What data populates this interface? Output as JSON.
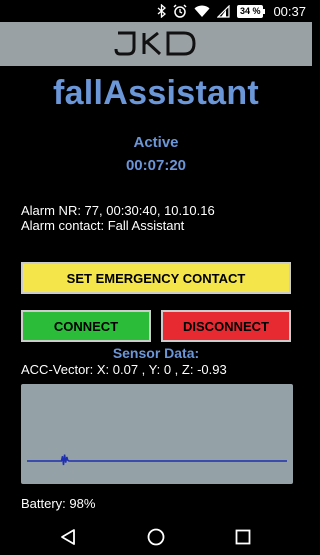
{
  "status_bar": {
    "battery_percent": "34 %",
    "time": "00:37",
    "icons": [
      "bluetooth-icon",
      "alarm-clock-icon",
      "wifi-icon",
      "cell-signal-icon",
      "battery-icon"
    ]
  },
  "header": {
    "logo_text": "JKD"
  },
  "app": {
    "title": "fallAssistant",
    "state": "Active",
    "timer": "00:07:20",
    "alarm_nr": "Alarm NR: 77, 00:30:40, 10.10.16",
    "alarm_contact": "Alarm contact: Fall Assistant"
  },
  "buttons": {
    "emergency": "SET EMERGENCY CONTACT",
    "connect": "CONNECT",
    "disconnect": "DISCONNECT"
  },
  "sensor": {
    "title": "Sensor Data:",
    "acc_label": "ACC-Vector:",
    "x": "X: 0.07 ,",
    "y": "Y: 0 ,",
    "z": "Z: -0.93",
    "graph_series": [
      0,
      0,
      0,
      0,
      0,
      0,
      0,
      0,
      0,
      0,
      0,
      0,
      0,
      0,
      0,
      0,
      0,
      0,
      0,
      0,
      0,
      0,
      0,
      0,
      0,
      0,
      0,
      0,
      0,
      0,
      0,
      0,
      0,
      0.6,
      -0.5,
      0.8,
      -0.2,
      0.5,
      0.1,
      0,
      0,
      0,
      0,
      0,
      0,
      0,
      0,
      0,
      0,
      0,
      0,
      0,
      0,
      0,
      0,
      0,
      0,
      0,
      0,
      0,
      0,
      0,
      0,
      0,
      0,
      0,
      0,
      0,
      0,
      0,
      0,
      0,
      0,
      0,
      0,
      0,
      0,
      0,
      0,
      0,
      0,
      0,
      0,
      0,
      0,
      0,
      0,
      0,
      0,
      0,
      0,
      0,
      0,
      0,
      0,
      0,
      0,
      0,
      0,
      0,
      0,
      0,
      0,
      0,
      0,
      0,
      0,
      0,
      0,
      0,
      0,
      0,
      0,
      0,
      0,
      0,
      0,
      0,
      0,
      0,
      0,
      0,
      0,
      0,
      0,
      0,
      0,
      0,
      0,
      0,
      0,
      0,
      0,
      0,
      0,
      0,
      0,
      0,
      0,
      0,
      0,
      0,
      0,
      0,
      0,
      0,
      0,
      0,
      0,
      0,
      0,
      0,
      0,
      0,
      0,
      0,
      0,
      0,
      0,
      0,
      0,
      0,
      0,
      0,
      0,
      0,
      0,
      0,
      0,
      0,
      0,
      0,
      0,
      0,
      0,
      0,
      0,
      0,
      0,
      0,
      0,
      0,
      0,
      0,
      0,
      0,
      0,
      0,
      0,
      0,
      0,
      0,
      0,
      0,
      0,
      0,
      0,
      0,
      0,
      0,
      0,
      0,
      0,
      0,
      0,
      0,
      0,
      0,
      0,
      0,
      0,
      0,
      0,
      0,
      0,
      0,
      0,
      0,
      0,
      0,
      0,
      0,
      0,
      0,
      0,
      0,
      0,
      0,
      0,
      0,
      0,
      0,
      0,
      0,
      0,
      0,
      0,
      0,
      0,
      0,
      0,
      0,
      0
    ],
    "graph_color": "#1e2fb0"
  },
  "battery": {
    "text": "Battery: 98%"
  },
  "nav": {
    "icons": [
      "back-icon",
      "home-icon",
      "recents-icon"
    ]
  },
  "colors": {
    "accent_blue": "#6b96d8",
    "header_gray": "#9aa1a5",
    "emergency_yellow": "#f4e54a",
    "connect_green": "#2bbd3a",
    "disconnect_red": "#e72a32"
  }
}
